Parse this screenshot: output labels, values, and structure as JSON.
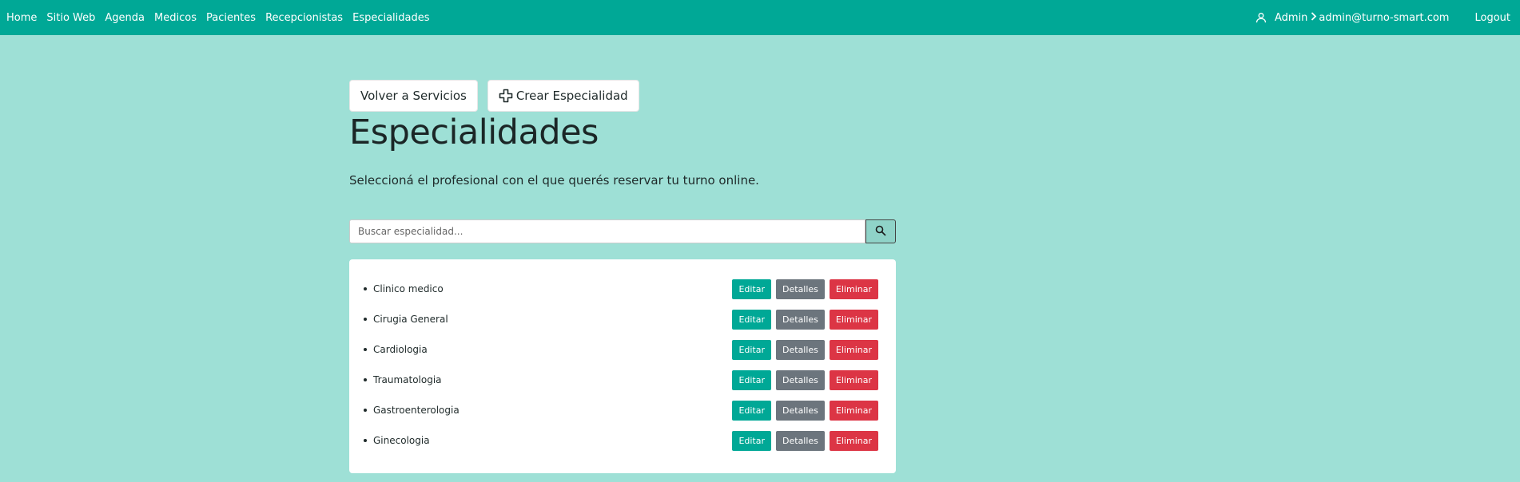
{
  "nav": {
    "links": [
      "Home",
      "Sitio Web",
      "Agenda",
      "Medicos",
      "Pacientes",
      "Recepcionistas",
      "Especialidades"
    ],
    "user_label": "Admin",
    "user_email": "admin@turno-smart.com",
    "logout": "Logout"
  },
  "toolbar": {
    "back_label": "Volver a Servicios",
    "create_label": "Crear Especialidad"
  },
  "page": {
    "title": "Especialidades",
    "subtitle": "Seleccioná el profesional con el que querés reservar tu turno online."
  },
  "search": {
    "placeholder": "Buscar especialidad...",
    "value": ""
  },
  "actions": {
    "edit": "Editar",
    "details": "Detalles",
    "delete": "Eliminar"
  },
  "specialties": [
    "Clinico medico",
    "Cirugia General",
    "Cardiologia",
    "Traumatologia",
    "Gastroenterologia",
    "Ginecologia"
  ],
  "colors": {
    "primary": "#00a896",
    "background": "#9ee0d6",
    "secondary": "#6c757d",
    "danger": "#dc3545"
  },
  "icons": {
    "user": "user-icon",
    "chevron": "chevron-right-icon",
    "plus": "plus-icon",
    "search": "search-icon"
  }
}
